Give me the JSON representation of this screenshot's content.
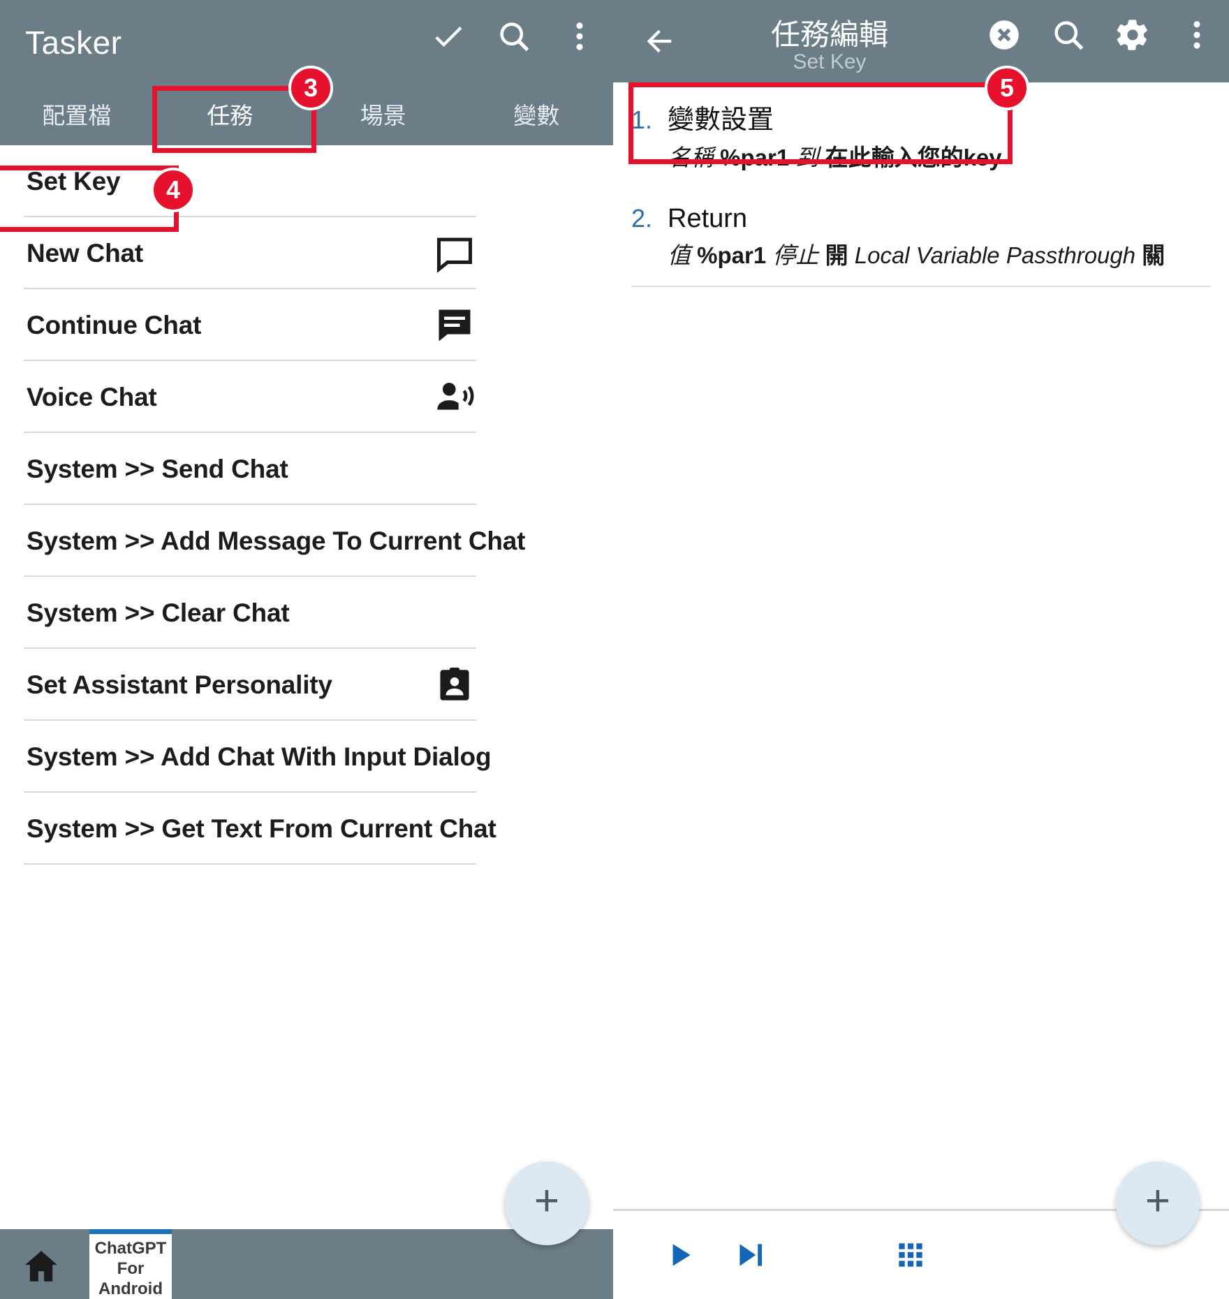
{
  "left": {
    "app_title": "Tasker",
    "appbar_icons": [
      "check-icon",
      "search-icon",
      "more-vert-icon"
    ],
    "tabs": [
      {
        "label": "配置檔",
        "active": false
      },
      {
        "label": "任務",
        "active": true
      },
      {
        "label": "場景",
        "active": false
      },
      {
        "label": "變數",
        "active": false
      }
    ],
    "tasks": [
      {
        "label": "Set Key",
        "icon": ""
      },
      {
        "label": "New Chat",
        "icon": "chat-bubble-outline-icon"
      },
      {
        "label": "Continue Chat",
        "icon": "chat-bubble-filled-icon"
      },
      {
        "label": "Voice Chat",
        "icon": "voice-chat-icon"
      },
      {
        "label": "System >> Send Chat",
        "icon": ""
      },
      {
        "label": "System >> Add Message To Current Chat",
        "icon": ""
      },
      {
        "label": "System >> Clear Chat",
        "icon": ""
      },
      {
        "label": "Set Assistant Personality",
        "icon": "contact-card-icon"
      },
      {
        "label": "System >> Add Chat With Input Dialog",
        "icon": ""
      },
      {
        "label": "System >> Get Text From Current Chat",
        "icon": ""
      }
    ],
    "fab_label": "+",
    "nav": {
      "home_icon": "home-icon",
      "app_label": "ChatGPT For Android"
    }
  },
  "right": {
    "title": "任務編輯",
    "subtitle": "Set Key",
    "appbar_icons": [
      "close-circle-icon",
      "search-icon",
      "gear-icon",
      "more-vert-icon"
    ],
    "actions": [
      {
        "number": "1.",
        "name": "變數設置",
        "desc_parts": [
          {
            "text": "名稱 ",
            "bold": false
          },
          {
            "text": "%par1",
            "bold": true
          },
          {
            "text": " 到 ",
            "bold": false
          },
          {
            "text": "在此輸入您的key",
            "bold": true
          }
        ]
      },
      {
        "number": "2.",
        "name": "Return",
        "desc_parts": [
          {
            "text": "值 ",
            "bold": false
          },
          {
            "text": "%par1",
            "bold": true
          },
          {
            "text": " 停止 ",
            "bold": false
          },
          {
            "text": "開",
            "bold": true
          },
          {
            "text": " Local Variable Passthrough ",
            "bold": false
          },
          {
            "text": "關",
            "bold": true
          }
        ]
      }
    ],
    "fab_label": "+",
    "bottom_bar_icons": [
      "play-icon",
      "step-icon",
      "grid-icon"
    ]
  },
  "annotations": [
    {
      "badge": "3",
      "target": "tab-任務"
    },
    {
      "badge": "4",
      "target": "task-set-key"
    },
    {
      "badge": "5",
      "target": "action-1-variable-set"
    }
  ],
  "colors": {
    "appbar": "#6b7d86",
    "accent_red": "#e8112d",
    "action_number_blue": "#2e6fa3",
    "fab": "#dce9f3",
    "nav_tab_underline": "#1a73b7"
  }
}
